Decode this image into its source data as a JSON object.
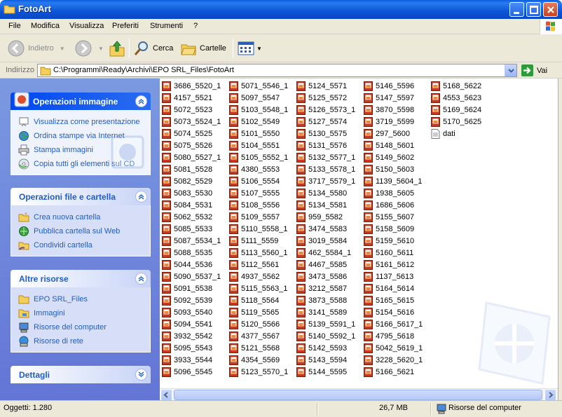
{
  "window": {
    "title": "FotoArt"
  },
  "menu": [
    "File",
    "Modifica",
    "Visualizza",
    "Preferiti",
    "Strumenti",
    "?"
  ],
  "toolbar": {
    "back_label": "Indietro",
    "search_label": "Cerca",
    "folders_label": "Cartelle"
  },
  "address": {
    "label": "Indirizzo",
    "path": "C:\\Programmi\\Ready\\Archivi\\EPO SRL_Files\\FotoArt",
    "go_label": "Vai"
  },
  "taskpane": {
    "image_tasks": {
      "title": "Operazioni immagine",
      "items": [
        {
          "label": "Visualizza come presentazione",
          "icon": "slideshow-icon"
        },
        {
          "label": "Ordina stampe via Internet",
          "icon": "globe-icon"
        },
        {
          "label": "Stampa immagini",
          "icon": "printer-icon"
        },
        {
          "label": "Copia tutti gli elementi sul CD",
          "icon": "cd-icon"
        }
      ]
    },
    "file_tasks": {
      "title": "Operazioni file e cartella",
      "items": [
        {
          "label": "Crea nuova cartella",
          "icon": "new-folder-icon"
        },
        {
          "label": "Pubblica cartella sul Web",
          "icon": "web-publish-icon"
        },
        {
          "label": "Condividi cartella",
          "icon": "share-folder-icon"
        }
      ]
    },
    "other_places": {
      "title": "Altre risorse",
      "items": [
        {
          "label": "EPO SRL_Files",
          "icon": "folder-icon"
        },
        {
          "label": "Immagini",
          "icon": "pictures-folder-icon"
        },
        {
          "label": "Risorse del computer",
          "icon": "computer-icon"
        },
        {
          "label": "Risorse di rete",
          "icon": "network-icon"
        }
      ]
    },
    "details": {
      "title": "Dettagli"
    }
  },
  "files": {
    "columns": [
      [
        "3686_5520_1",
        "4157_5521",
        "5072_5523",
        "5073_5524_1",
        "5074_5525",
        "5075_5526",
        "5080_5527_1",
        "5081_5528",
        "5082_5529",
        "5083_5530",
        "5084_5531",
        "5062_5532",
        "5085_5533",
        "5087_5534_1",
        "5088_5535",
        "5044_5536",
        "5090_5537_1",
        "5091_5538",
        "5092_5539",
        "5093_5540",
        "5094_5541",
        "3932_5542",
        "5095_5543",
        "3933_5544",
        "5096_5545"
      ],
      [
        "5071_5546_1",
        "5097_5547",
        "5103_5548_1",
        "5102_5549",
        "5101_5550",
        "5104_5551",
        "5105_5552_1",
        "4380_5553",
        "5106_5554",
        "5107_5555",
        "5108_5556",
        "5109_5557",
        "5110_5558_1",
        "5111_5559",
        "5113_5560_1",
        "5112_5561",
        "4937_5562",
        "5115_5563_1",
        "5118_5564",
        "5119_5565",
        "5120_5566",
        "4377_5567",
        "5121_5568",
        "4354_5569",
        "5123_5570_1"
      ],
      [
        "5124_5571",
        "5125_5572",
        "5126_5573_1",
        "5127_5574",
        "5130_5575",
        "5131_5576",
        "5132_5577_1",
        "5133_5578_1",
        "3717_5579_1",
        "5134_5580",
        "5134_5581",
        "959_5582",
        "3474_5583",
        "3019_5584",
        "462_5584_1",
        "4467_5585",
        "3473_5586",
        "3212_5587",
        "3873_5588",
        "3141_5589",
        "5139_5591_1",
        "5140_5592_1",
        "5142_5593",
        "5143_5594",
        "5144_5595"
      ],
      [
        "5146_5596",
        "5147_5597",
        "3870_5598",
        "3719_5599",
        "297_5600",
        "5148_5601",
        "5149_5602",
        "5150_5603",
        "1139_5604_1",
        "1938_5605",
        "1686_5606",
        "5155_5607",
        "5158_5609",
        "5159_5610",
        "5160_5611",
        "5161_5612",
        "1137_5613",
        "5164_5614",
        "5165_5615",
        "5154_5616",
        "5166_5617_1",
        "4795_5618",
        "5042_5619_1",
        "3228_5620_1",
        "5166_5621"
      ],
      [
        "5168_5622",
        "4553_5623",
        "5169_5624",
        "5170_5625",
        "dati"
      ]
    ]
  },
  "status": {
    "objects": "Oggetti: 1.280",
    "size": "26,7 MB",
    "location": "Risorse del computer"
  }
}
